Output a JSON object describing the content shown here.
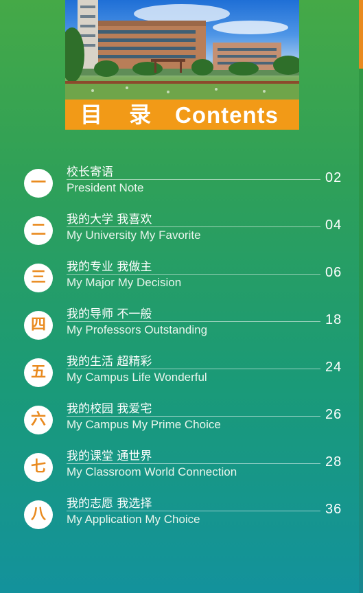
{
  "banner": {
    "title_cn": "目 录",
    "title_en": "Contents"
  },
  "colors": {
    "accent": "#f29a17",
    "bg_top": "#45a947",
    "bg_bottom": "#13929c"
  },
  "toc": [
    {
      "num": "一",
      "title_cn": "校长寄语",
      "title_en": "President Note",
      "page": "02"
    },
    {
      "num": "二",
      "title_cn": "我的大学 我喜欢",
      "title_en": "My University My Favorite",
      "page": "04"
    },
    {
      "num": "三",
      "title_cn": "我的专业 我做主",
      "title_en": "My Major My Decision",
      "page": "06"
    },
    {
      "num": "四",
      "title_cn": "我的导师 不一般",
      "title_en": "My Professors Outstanding",
      "page": "18"
    },
    {
      "num": "五",
      "title_cn": "我的生活 超精彩",
      "title_en": "My Campus Life Wonderful",
      "page": "24"
    },
    {
      "num": "六",
      "title_cn": "我的校园 我爱宅",
      "title_en": "My Campus My Prime Choice",
      "page": "26"
    },
    {
      "num": "七",
      "title_cn": "我的课堂 通世界",
      "title_en": "My Classroom World Connection",
      "page": "28"
    },
    {
      "num": "八",
      "title_cn": "我的志愿 我选择",
      "title_en": "My Application My Choice",
      "page": "36"
    }
  ]
}
